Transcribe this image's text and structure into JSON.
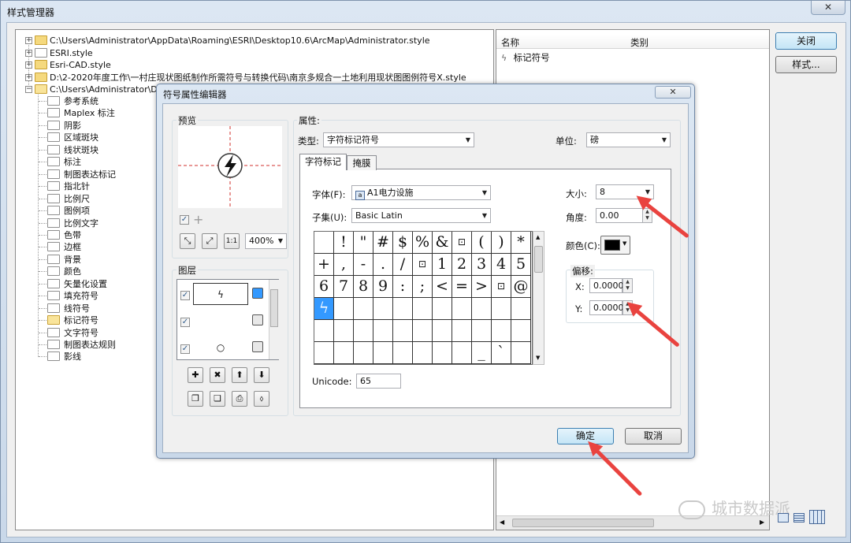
{
  "manager": {
    "title": "样式管理器",
    "close_glyph": "✕",
    "tree": [
      {
        "label": "C:\\Users\\Administrator\\AppData\\Roaming\\ESRI\\Desktop10.6\\ArcMap\\Administrator.style",
        "toggle": "+"
      },
      {
        "label": "ESRI.style",
        "toggle": "+"
      },
      {
        "label": "Esri-CAD.style",
        "toggle": "+"
      },
      {
        "label": "D:\\2-2020年度工作\\一村庄现状图纸制作所需符号与转换代码\\南京多规合一土地利用现状图图例符号X.style",
        "toggle": "+"
      },
      {
        "label": "C:\\Users\\Administrator\\Desktop\\符号\\",
        "toggle": "−"
      }
    ],
    "folders": [
      "参考系统",
      "Maplex 标注",
      "阴影",
      "区域斑块",
      "线状斑块",
      "标注",
      "制图表达标记",
      "指北针",
      "比例尺",
      "图例项",
      "比例文字",
      "色带",
      "边框",
      "背景",
      "颜色",
      "矢量化设置",
      "填充符号",
      "线符号",
      "标记符号",
      "文字符号",
      "制图表达规则",
      "影线"
    ],
    "list": {
      "col_name": "名称",
      "col_category": "类别",
      "items": [
        {
          "name": "标记符号"
        }
      ]
    },
    "buttons": {
      "close": "关闭",
      "styles": "样式..."
    },
    "watermark": "城市数据派"
  },
  "editor": {
    "title": "符号属性编辑器",
    "close_glyph": "✕",
    "preview": {
      "label": "预览",
      "zoom": "400%",
      "check": "✓",
      "plus": "+",
      "zoom_buttons": [
        "⤡",
        "⤢",
        "1:1"
      ]
    },
    "layers": {
      "label": "图层",
      "rows": [
        {
          "checked": "✓",
          "symbol": "ϟ"
        },
        {
          "checked": "✓",
          "symbol": ""
        },
        {
          "checked": "✓",
          "symbol": "○"
        }
      ],
      "tool_row1": [
        "✚",
        "✖",
        "⬆",
        "⬇"
      ],
      "tool_row2": [
        "❐",
        "❏",
        "⎙",
        "⬨"
      ]
    },
    "properties": {
      "label": "属性:",
      "type_label": "类型:",
      "type_value": "字符标记符号",
      "unit_label": "单位:",
      "unit_value": "磅",
      "tabs": [
        "字符标记",
        "掩膜"
      ],
      "font_label": "字体(F):",
      "font_value": "A1电力设施",
      "subset_label": "子集(U):",
      "subset_value": "Basic Latin",
      "size_label": "大小:",
      "size_value": "8",
      "angle_label": "角度:",
      "angle_value": "0.00",
      "color_label": "颜色(C):",
      "color_swatch": "#000000",
      "offset_label": "偏移:",
      "x_label": "X:",
      "x_value": "0.0000",
      "y_label": "Y:",
      "y_value": "0.0000",
      "unicode_label": "Unicode:",
      "unicode_value": "65",
      "glyphs": [
        "",
        "!",
        "\"",
        "#",
        "$",
        "%",
        "&",
        "⊡",
        "(",
        ")",
        "*",
        "+",
        ",",
        "-",
        ".",
        "/",
        "⊡",
        "1",
        "2",
        "3",
        "4",
        "5",
        "6",
        "7",
        "8",
        "9",
        ":",
        ";",
        "<",
        "=",
        ">",
        "⊡",
        "@",
        "ϟ",
        "",
        "",
        "",
        "",
        "",
        "",
        "",
        "",
        "",
        "",
        "",
        "",
        "",
        "",
        "",
        "",
        "",
        "",
        "",
        "",
        "",
        "",
        "",
        "",
        "",
        "",
        "",
        "",
        "",
        "_",
        "`",
        ""
      ],
      "selected_index": 33
    },
    "buttons": {
      "ok": "确定",
      "cancel": "取消"
    }
  },
  "colors": {
    "arrow": "#e9433f",
    "selection": "#3399ff"
  }
}
